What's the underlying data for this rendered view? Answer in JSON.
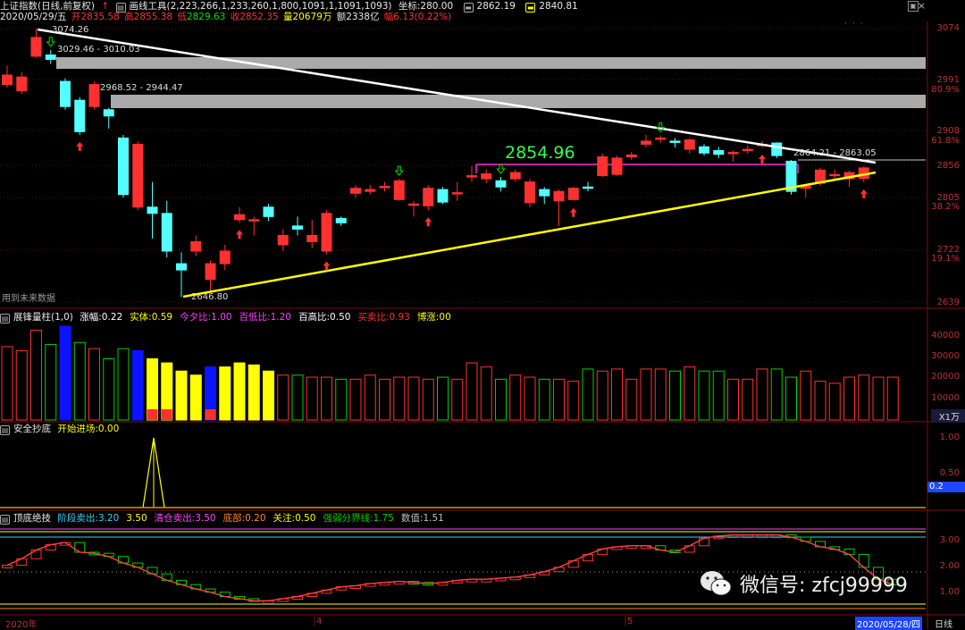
{
  "colors": {
    "up": "#ff3030",
    "down": "#54ffff",
    "grid": "#7a1010",
    "yellow": "#ffff00",
    "white": "#ffffff",
    "magenta": "#ff2ad4",
    "green": "#00d000",
    "blue": "#0a14ff"
  },
  "topbar": {
    "title": "上证指数(日线,前复权)",
    "arrow": "↑",
    "tool": "画线工具(2,223,266,1,233,260,1,800,1091,1,1091,1093)",
    "coord_label": "坐标:",
    "coord_value": "280.00",
    "price1": "2862.19",
    "price2": "2840.81"
  },
  "quotebar": {
    "date": "2020/05/29/五",
    "open_label": "开",
    "open": "2835.58",
    "high_label": "高",
    "high": "2855.38",
    "low_label": "低",
    "low": "2829.63",
    "close_label": "收",
    "close": "2852.35",
    "vol_label": "量",
    "vol": "20679万",
    "amt_label": "额",
    "amt": "2338亿",
    "chg_label": "幅",
    "chg": "6.13(0.22%)"
  },
  "price_axis": {
    "ticks": [
      "3074",
      "2991",
      "2908",
      "2856",
      "2805",
      "2722",
      "2639"
    ],
    "pcts": [
      "80.9%",
      "61.8%",
      "38.2%",
      "19.1%"
    ]
  },
  "annotations": {
    "high_label": "3074.26",
    "band1": "3029.46 - 3010.03",
    "band2": "2968.52 - 2944.47",
    "big_price": "2854.96",
    "right_band": "2864.21 - 2863.05",
    "low_label": "2646.80",
    "future_note": "用到未来数据"
  },
  "panel2": {
    "title": "展锋量柱(1,0)",
    "items": [
      {
        "label": "涨幅:",
        "value": "0.22",
        "color": "#ffffff"
      },
      {
        "label": "实体:",
        "value": "0.59",
        "color": "#ffff00"
      },
      {
        "label": "今夕比:",
        "value": "1.00",
        "color": "#ff40ff"
      },
      {
        "label": "百低比:",
        "value": "1.20",
        "color": "#ff40ff"
      },
      {
        "label": "百高比:",
        "value": "0.50",
        "color": "#ffffff"
      },
      {
        "label": "买卖比:",
        "value": "0.93",
        "color": "#ff3030"
      },
      {
        "label": "博涨:",
        "value": "00",
        "color": "#ffff00"
      }
    ],
    "axis": [
      "40000",
      "30000",
      "20000",
      "10000"
    ],
    "unit": "X1万"
  },
  "panel3": {
    "title": "安全抄底",
    "item_label": "开始进场:",
    "item_value": "0.00",
    "axis": [
      "1.00",
      "0.50"
    ],
    "current": "0.2"
  },
  "panel4": {
    "title": "顶底绝技",
    "items": [
      {
        "label": "阶段卖出:",
        "value": "3.20",
        "color": "#30d0ff"
      },
      {
        "label": "",
        "value": "3.50",
        "color": "#ffff00"
      },
      {
        "label": "清仓卖出:",
        "value": "3.50",
        "color": "#ff40ff"
      },
      {
        "label": "底部:",
        "value": "0.20",
        "color": "#ff8030"
      },
      {
        "label": "关注:",
        "value": "0.50",
        "color": "#ffff00"
      },
      {
        "label": "强弱分界线:",
        "value": "1.75",
        "color": "#00d000"
      },
      {
        "label": "数值:",
        "value": "1.51",
        "color": "#c0c0c0"
      }
    ],
    "axis": [
      "3.00",
      "2.00",
      "1.00"
    ]
  },
  "bottom": {
    "year_label": "2020年",
    "m4": "4",
    "m5": "5",
    "date_label": "2020/05/28/四",
    "period": "日线"
  },
  "watermark": "微信号: zfcj99999",
  "chart_data": {
    "type": "candlestick",
    "title": "上证指数(日线,前复权)",
    "ylim": [
      2620,
      3100
    ],
    "candles": [
      {
        "o": 2985,
        "c": 3000,
        "h": 3015,
        "l": 2980
      },
      {
        "o": 2975,
        "c": 2997,
        "h": 3005,
        "l": 2970
      },
      {
        "o": 3030,
        "c": 3060,
        "h": 3074.26,
        "l": 3028
      },
      {
        "o": 3032,
        "c": 3025,
        "h": 3040,
        "l": 3018
      },
      {
        "o": 2990,
        "c": 2950,
        "h": 2995,
        "l": 2945
      },
      {
        "o": 2960,
        "c": 2910,
        "h": 2965,
        "l": 2905
      },
      {
        "o": 2950,
        "c": 2985,
        "h": 2990,
        "l": 2945
      },
      {
        "o": 2945,
        "c": 2935,
        "h": 2948,
        "l": 2915
      },
      {
        "o": 2900,
        "c": 2810,
        "h": 2905,
        "l": 2805
      },
      {
        "o": 2790,
        "c": 2890,
        "h": 2895,
        "l": 2785
      },
      {
        "o": 2790,
        "c": 2780,
        "h": 2830,
        "l": 2740
      },
      {
        "o": 2780,
        "c": 2720,
        "h": 2800,
        "l": 2710
      },
      {
        "o": 2700,
        "c": 2690,
        "h": 2718,
        "l": 2646.8
      },
      {
        "o": 2720,
        "c": 2735,
        "h": 2745,
        "l": 2712
      },
      {
        "o": 2675,
        "c": 2700,
        "h": 2705,
        "l": 2655
      },
      {
        "o": 2700,
        "c": 2720,
        "h": 2730,
        "l": 2690
      },
      {
        "o": 2770,
        "c": 2778,
        "h": 2790,
        "l": 2765
      },
      {
        "o": 2768,
        "c": 2770,
        "h": 2775,
        "l": 2745
      },
      {
        "o": 2790,
        "c": 2775,
        "h": 2795,
        "l": 2768
      },
      {
        "o": 2730,
        "c": 2745,
        "h": 2755,
        "l": 2720
      },
      {
        "o": 2760,
        "c": 2755,
        "h": 2775,
        "l": 2745
      },
      {
        "o": 2735,
        "c": 2745,
        "h": 2770,
        "l": 2725
      },
      {
        "o": 2720,
        "c": 2780,
        "h": 2785,
        "l": 2715
      },
      {
        "o": 2772,
        "c": 2765,
        "h": 2775,
        "l": 2760
      },
      {
        "o": 2812,
        "c": 2820,
        "h": 2825,
        "l": 2805
      },
      {
        "o": 2815,
        "c": 2818,
        "h": 2825,
        "l": 2810
      },
      {
        "o": 2822,
        "c": 2823,
        "h": 2830,
        "l": 2815
      },
      {
        "o": 2802,
        "c": 2832,
        "h": 2835,
        "l": 2800
      },
      {
        "o": 2793,
        "c": 2795,
        "h": 2800,
        "l": 2775
      },
      {
        "o": 2792,
        "c": 2820,
        "h": 2825,
        "l": 2785
      },
      {
        "o": 2818,
        "c": 2798,
        "h": 2822,
        "l": 2795
      },
      {
        "o": 2812,
        "c": 2813,
        "h": 2830,
        "l": 2800
      },
      {
        "o": 2838,
        "c": 2840,
        "h": 2855,
        "l": 2830
      },
      {
        "o": 2835,
        "c": 2843,
        "h": 2850,
        "l": 2828
      },
      {
        "o": 2832,
        "c": 2822,
        "h": 2838,
        "l": 2815
      },
      {
        "o": 2835,
        "c": 2845,
        "h": 2850,
        "l": 2830
      },
      {
        "o": 2797,
        "c": 2830,
        "h": 2835,
        "l": 2790
      },
      {
        "o": 2818,
        "c": 2808,
        "h": 2822,
        "l": 2795
      },
      {
        "o": 2800,
        "c": 2815,
        "h": 2818,
        "l": 2760
      },
      {
        "o": 2802,
        "c": 2820,
        "h": 2822,
        "l": 2800
      },
      {
        "o": 2822,
        "c": 2820,
        "h": 2830,
        "l": 2815
      },
      {
        "o": 2840,
        "c": 2870,
        "h": 2875,
        "l": 2838
      },
      {
        "o": 2842,
        "c": 2868,
        "h": 2872,
        "l": 2840
      },
      {
        "o": 2870,
        "c": 2873,
        "h": 2878,
        "l": 2865
      },
      {
        "o": 2890,
        "c": 2895,
        "h": 2905,
        "l": 2885
      },
      {
        "o": 2898,
        "c": 2900,
        "h": 2904,
        "l": 2892
      },
      {
        "o": 2895,
        "c": 2894,
        "h": 2900,
        "l": 2885
      },
      {
        "o": 2882,
        "c": 2897,
        "h": 2900,
        "l": 2875
      },
      {
        "o": 2886,
        "c": 2876,
        "h": 2890,
        "l": 2872
      },
      {
        "o": 2880,
        "c": 2874,
        "h": 2886,
        "l": 2868
      },
      {
        "o": 2875,
        "c": 2877,
        "h": 2880,
        "l": 2862
      },
      {
        "o": 2880,
        "c": 2882,
        "h": 2888,
        "l": 2875
      },
      {
        "o": 2888,
        "c": 2890,
        "h": 2895,
        "l": 2885
      },
      {
        "o": 2892,
        "c": 2872,
        "h": 2893,
        "l": 2868
      },
      {
        "o": 2863,
        "c": 2815,
        "h": 2865,
        "l": 2810
      },
      {
        "o": 2820,
        "c": 2823,
        "h": 2825,
        "l": 2805
      },
      {
        "o": 2828,
        "c": 2849,
        "h": 2852,
        "l": 2824
      },
      {
        "o": 2840,
        "c": 2842,
        "h": 2850,
        "l": 2835
      },
      {
        "o": 2835,
        "c": 2845,
        "h": 2848,
        "l": 2822
      },
      {
        "o": 2835.58,
        "c": 2852.35,
        "h": 2855.38,
        "l": 2829.63
      }
    ],
    "volumes": [
      36000,
      34000,
      44000,
      37000,
      46000,
      38000,
      35000,
      30000,
      35000,
      34000,
      30000,
      28000,
      24000,
      22000,
      26000,
      26000,
      28000,
      27000,
      24000,
      22000,
      22000,
      21000,
      21000,
      20000,
      20000,
      22000,
      20000,
      21000,
      21000,
      20000,
      21000,
      20000,
      28000,
      26000,
      20000,
      22000,
      21000,
      20000,
      20000,
      19000,
      25000,
      24000,
      25000,
      20000,
      25000,
      25000,
      24000,
      26000,
      24000,
      24000,
      20000,
      20000,
      25000,
      25000,
      21000,
      24000,
      19000,
      18000,
      21000,
      22000,
      21000,
      21000
    ]
  }
}
